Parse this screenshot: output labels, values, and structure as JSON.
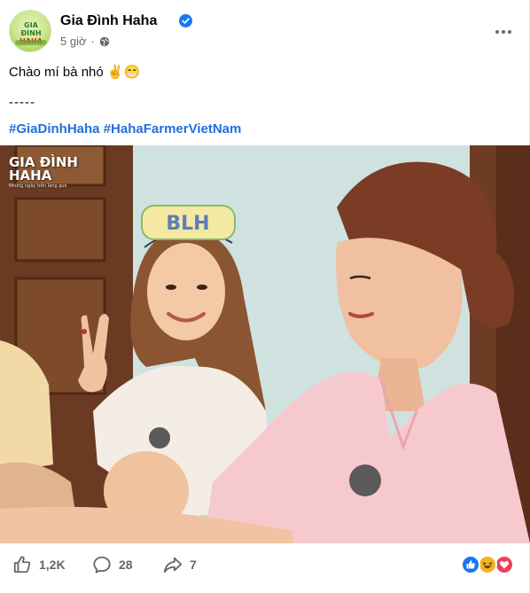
{
  "post": {
    "page_name": "Gia Đình Haha",
    "time": "5 giờ",
    "separator": "·",
    "avatar_logo": [
      "GIA ĐÌNH",
      "HAHA"
    ],
    "text_line1": "Chào mí bà nhó ✌️😁",
    "text_line2": "-----",
    "hashtags": [
      "#GiaDinhHaha",
      "#HahaFarmerVietNam"
    ],
    "photo": {
      "watermark_line1": "GIA ĐÌNH",
      "watermark_line2": "HAHA",
      "watermark_sub": "Những ngày trên làng quê",
      "headband_text": "BLH"
    }
  },
  "actions": {
    "like_count": "1,2K",
    "comment_count": "28",
    "share_count": "7"
  },
  "icons": {
    "verified": "verified-badge-icon",
    "globe": "globe-icon",
    "more": "more-options-icon",
    "like": "thumbs-up-icon",
    "comment": "comment-icon",
    "share": "share-icon",
    "reactions": [
      "like-reaction-icon",
      "haha-reaction-icon",
      "love-reaction-icon"
    ]
  },
  "colors": {
    "brand_blue": "#1877f2",
    "hashtag": "#216fdb",
    "muted": "#65676b",
    "love": "#f33e58",
    "haha": "#f7b125"
  }
}
